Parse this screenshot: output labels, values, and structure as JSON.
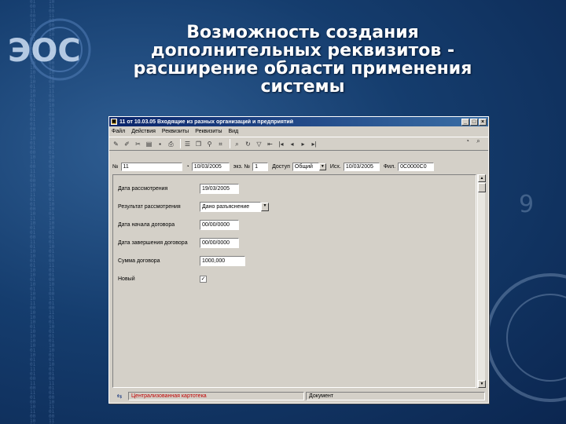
{
  "slide": {
    "title_lines": [
      "Возможность создания",
      "дополнительных реквизитов -",
      "расширение области применения",
      "системы"
    ]
  },
  "window": {
    "title": "11 от 10.03.05 Входящие из разных организаций и предприятий",
    "minimize": "_",
    "maximize": "□",
    "close": "×",
    "menu": [
      "Файл",
      "Действия",
      "Реквизиты",
      "Реквизиты",
      "Вид"
    ],
    "toolbar_icons": [
      "new-icon",
      "edit-icon",
      "delete-icon",
      "folder-icon",
      "save-icon",
      "print-icon",
      "details-icon",
      "copy-icon",
      "link-icon",
      "attach-icon",
      "search-icon",
      "refresh-icon",
      "filter-icon",
      "back-icon",
      "first-icon",
      "prev-icon",
      "next-icon",
      "last-icon",
      "help-icon",
      "zoom-icon"
    ],
    "header": {
      "number_label": "№",
      "number_value": "11",
      "date_value": "10/03/2005",
      "copies_label": "экз. №",
      "copies_value": "1",
      "access_label": "Доступ",
      "access_value": "Общий",
      "date2_label": "Исх.",
      "date2_value": "10/03/2005",
      "field_label": "Фил.",
      "field_value": "0C0000C0"
    },
    "fields": [
      {
        "label": "Дата рассмотрения",
        "value": "19/03/2005",
        "kind": "text"
      },
      {
        "label": "Результат рассмотрения",
        "value": "Дано разъяснение",
        "kind": "select"
      },
      {
        "label": "Дата начала договора",
        "value": "00/00/0000",
        "kind": "text"
      },
      {
        "label": "Дата завершения договора",
        "value": "00/00/0000",
        "kind": "text"
      },
      {
        "label": "Сумма договора",
        "value": "1000,000",
        "kind": "text"
      },
      {
        "label": "Новый",
        "value": "✓",
        "kind": "checkbox"
      }
    ],
    "status": {
      "cell1": "Централизованная картотека",
      "cell2": "Документ"
    },
    "colors": {
      "titlebar": "#0a246a",
      "status_text": "#c00000"
    }
  }
}
